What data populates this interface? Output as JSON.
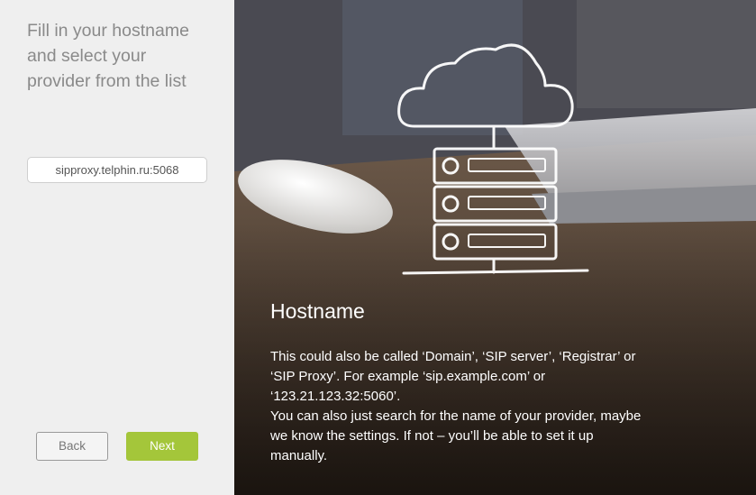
{
  "sidebar": {
    "heading": " Fill in your hostname\nand select your\nprovider from the list",
    "hostname_input": {
      "value": "sipproxy.telphin.ru:5068",
      "placeholder": ""
    },
    "back_label": "Back",
    "next_label": "Next"
  },
  "info": {
    "title": "Hostname",
    "body": " This could also be called ‘Domain’, ‘SIP server’, ‘Registrar’ or\n‘SIP Proxy’. For example ‘sip.example.com’ or\n‘123.21.123.32:5060’.\nYou can also just search for the name of your provider, maybe\nwe know the settings. If not – you’ll be able to set it up\nmanually."
  },
  "colors": {
    "accent": "#a4c63a",
    "sidebar_bg": "#efefef",
    "heading_text": "#8a8a8a"
  },
  "icons": [
    "cloud-server-illustration"
  ]
}
